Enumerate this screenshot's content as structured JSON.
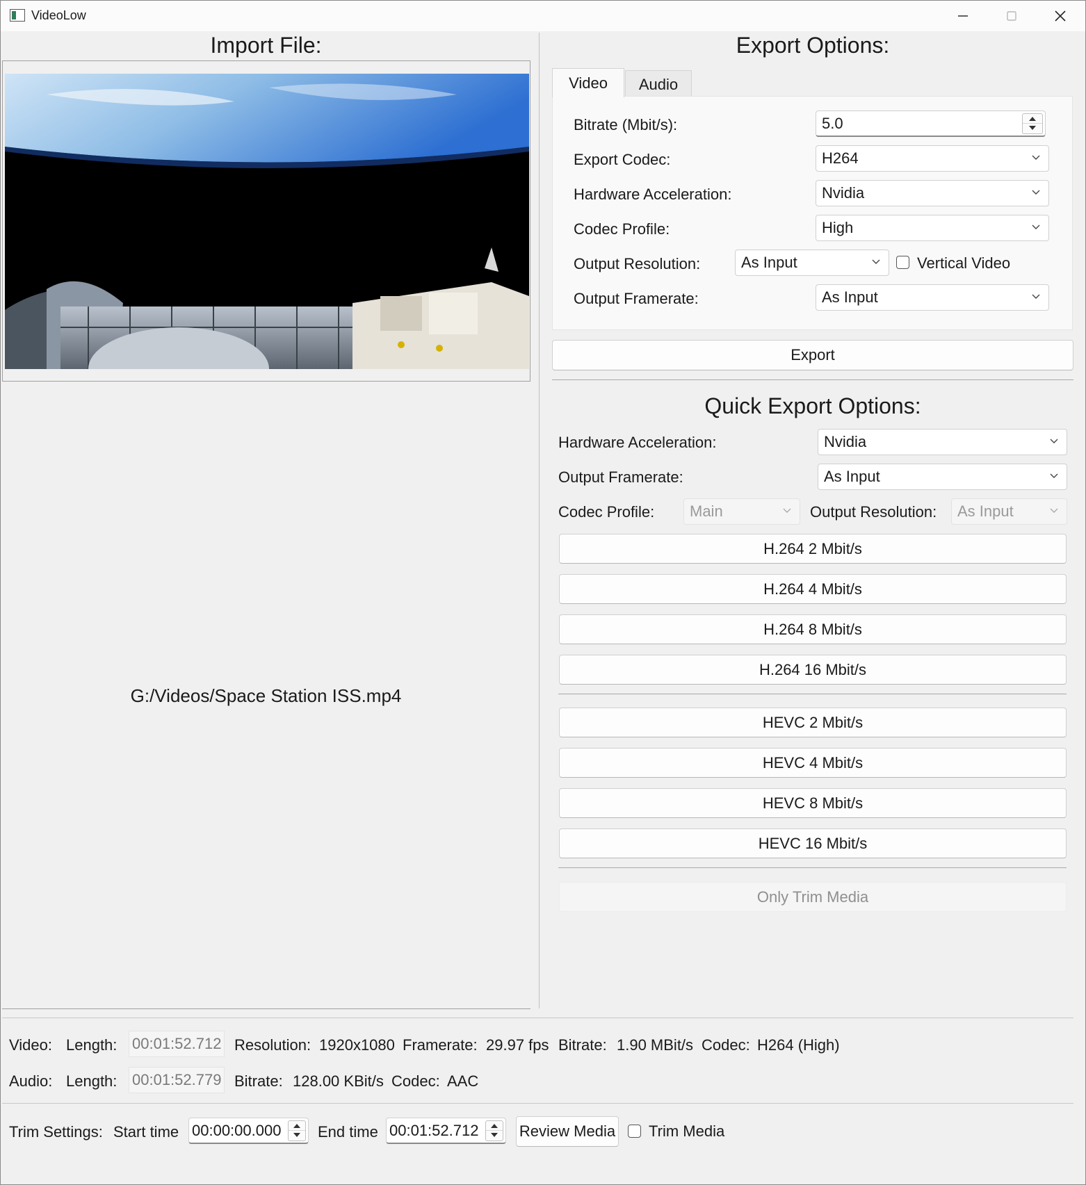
{
  "window": {
    "title": "VideoLow"
  },
  "left": {
    "heading": "Import File:",
    "file_path": "G:/Videos/Space Station ISS.mp4"
  },
  "export": {
    "heading": "Export Options:",
    "tabs": [
      "Video",
      "Audio"
    ],
    "active_tab": "Video",
    "bitrate_label": "Bitrate (Mbit/s):",
    "bitrate_value": "5.0",
    "codec_label": "Export Codec:",
    "codec_value": "H264",
    "hwaccel_label": "Hardware Acceleration:",
    "hwaccel_value": "Nvidia",
    "profile_label": "Codec Profile:",
    "profile_value": "High",
    "resolution_label": "Output Resolution:",
    "resolution_value": "As Input",
    "vertical_label": "Vertical Video",
    "framerate_label": "Output Framerate:",
    "framerate_value": "As Input",
    "export_button": "Export"
  },
  "quick": {
    "heading": "Quick Export Options:",
    "hwaccel_label": "Hardware Acceleration:",
    "hwaccel_value": "Nvidia",
    "framerate_label": "Output Framerate:",
    "framerate_value": "As Input",
    "profile_label": "Codec Profile:",
    "profile_value": "Main",
    "resolution_label": "Output Resolution:",
    "resolution_value": "As Input",
    "h264_buttons": [
      "H.264 2 Mbit/s",
      "H.264 4 Mbit/s",
      "H.264 8 Mbit/s",
      "H.264 16 Mbit/s"
    ],
    "hevc_buttons": [
      "HEVC 2 Mbit/s",
      "HEVC 4 Mbit/s",
      "HEVC 8 Mbit/s",
      "HEVC 16 Mbit/s"
    ],
    "trim_only_button": "Only Trim Media"
  },
  "info": {
    "video_label": "Video:",
    "audio_label": "Audio:",
    "length_label": "Length:",
    "video_length": "00:01:52.712",
    "audio_length": "00:01:52.779",
    "resolution_label": "Resolution:",
    "resolution_value": "1920x1080",
    "framerate_label": "Framerate:",
    "framerate_value": "29.97 fps",
    "bitrate_label": "Bitrate:",
    "video_bitrate": "1.90 MBit/s",
    "audio_bitrate": "128.00 KBit/s",
    "codec_label": "Codec:",
    "video_codec": "H264 (High)",
    "audio_codec": "AAC"
  },
  "trim": {
    "settings_label": "Trim Settings:",
    "start_label": "Start time",
    "start_value": "00:00:00.000",
    "end_label": "End time",
    "end_value": "00:01:52.712",
    "review_button": "Review Media",
    "trim_checkbox_label": "Trim Media"
  }
}
